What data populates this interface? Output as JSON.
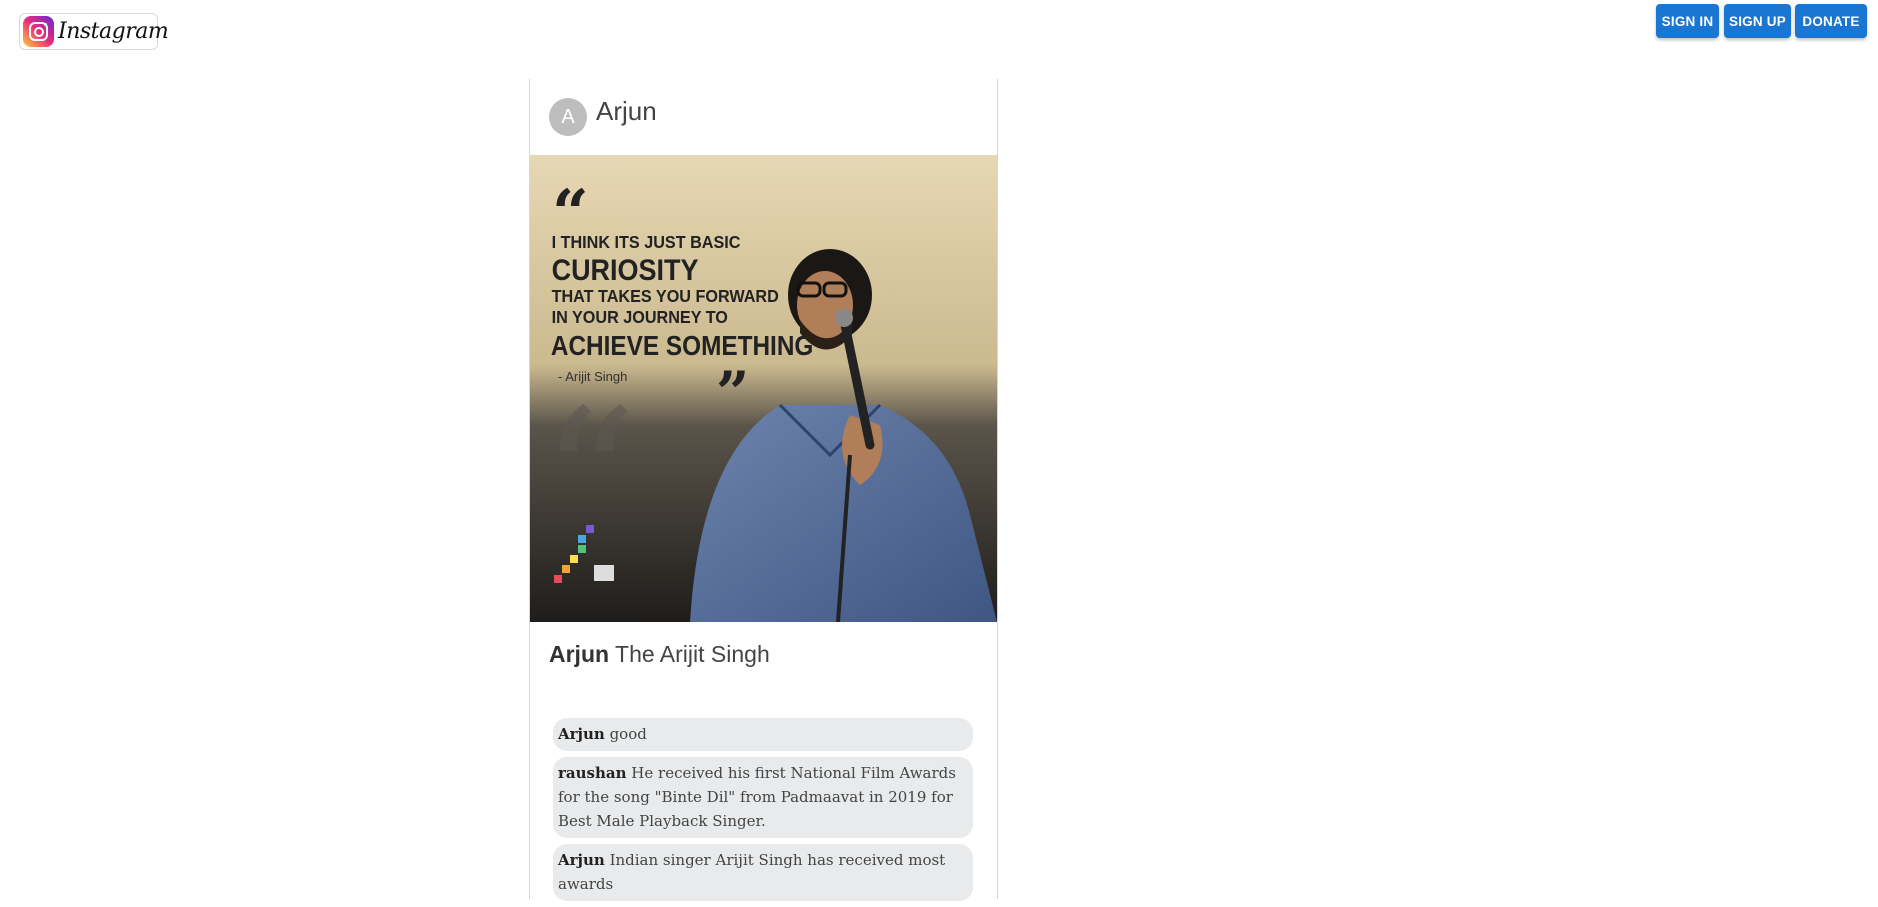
{
  "header": {
    "logo_text": "Instagram",
    "buttons": {
      "signin": "SIGN IN",
      "signup": "SIGN UP",
      "donate": "DONATE"
    }
  },
  "post": {
    "avatar_initial": "A",
    "username": "Arjun",
    "image": {
      "quote_line1": "I THINK ITS JUST BASIC",
      "quote_line2": "CURIOSITY",
      "quote_line3": "THAT TAKES YOU FORWARD",
      "quote_line4": "IN YOUR JOURNEY TO",
      "quote_line5": "ACHIEVE SOMETHING",
      "attribution": "- Arijit Singh"
    },
    "caption_user": "Arjun",
    "caption_text": "The Arijit Singh",
    "comments": [
      {
        "user": "Arjun",
        "text": "good"
      },
      {
        "user": "raushan",
        "text": "He received his first National Film Awards for the song \"Binte Dil\" from Padmaavat in 2019 for Best Male Playback Singer."
      },
      {
        "user": "Arjun",
        "text": "Indian singer Arijit Singh has received most awards"
      }
    ]
  },
  "colors": {
    "primary_button": "#1976d2",
    "comment_bg": "#e8eaeb",
    "avatar_bg": "#bdbdbd"
  }
}
